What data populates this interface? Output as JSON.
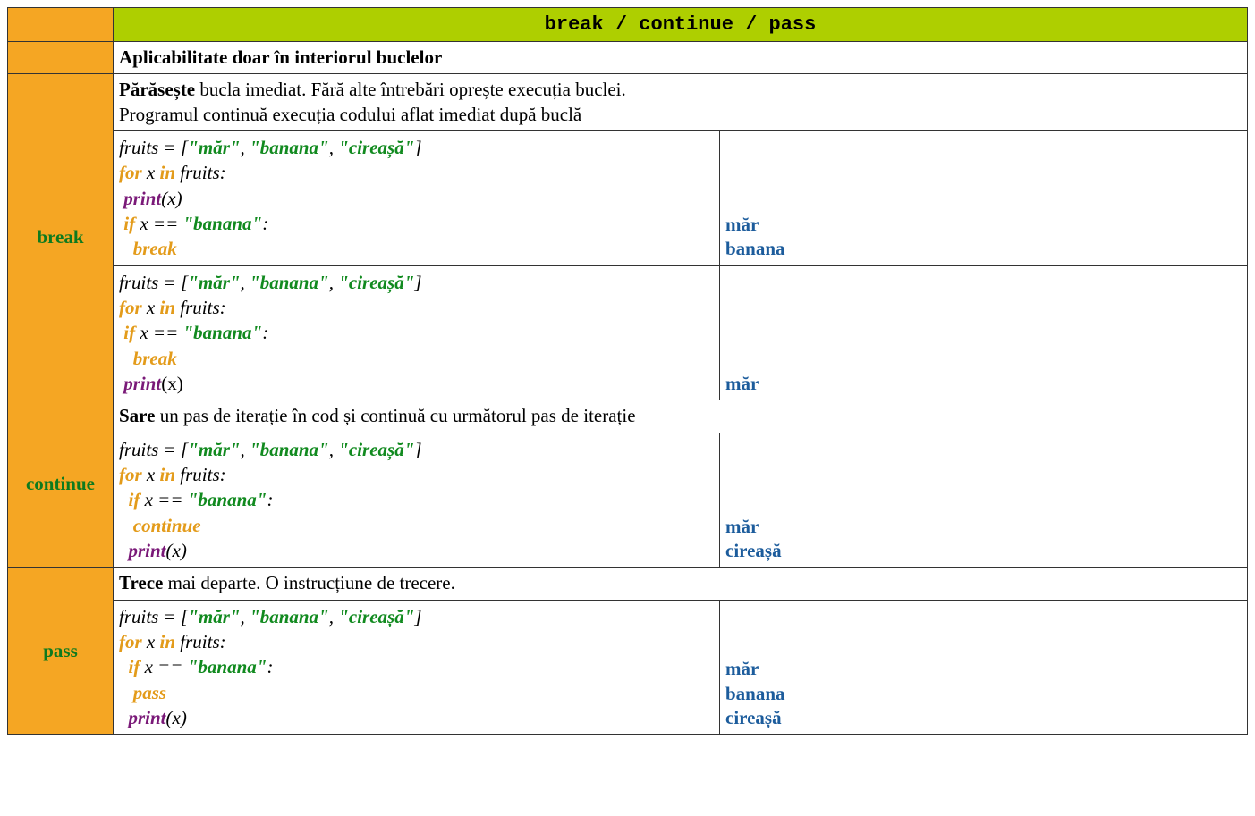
{
  "header": "break / continue / pass",
  "intro": "Aplicabilitate doar în interiorul buclelor",
  "sections": {
    "break": {
      "label": "break",
      "desc_b": "Părăsește",
      "desc_rest": " bucla imediat. Fără alte întrebări oprește execuția buclei.",
      "desc_line2": "Programul continuă execuția codului aflat imediat după buclă",
      "ex": [
        {
          "assign_fruits": "fruits = [",
          "s1": "\"măr\"",
          "c1": ", ",
          "s2": "\"banana\"",
          "c2": ", ",
          "s3": "\"cireașă\"",
          "close": "]",
          "for": "for",
          "x": " x ",
          "in": "in",
          "fruits": " fruits:",
          "print": "print",
          "px": "(x)",
          "if": "if",
          "cond": " x == ",
          "val": "\"banana\"",
          "colon": ":",
          "stmt": "break",
          "out1": "măr",
          "out2": "banana"
        },
        {
          "assign_fruits": "fruits = [",
          "s1": "\"măr\"",
          "c1": ", ",
          "s2": "\"banana\"",
          "c2": ", ",
          "s3": "\"cireașă\"",
          "close": "]",
          "for": "for",
          "x": " x ",
          "in": "in",
          "fruits": " fruits:",
          "if": "if",
          "cond": " x == ",
          "val": "\"banana\"",
          "colon": ":",
          "stmt": "break",
          "print": "print",
          "px": "(x)",
          "out1": "măr"
        }
      ]
    },
    "continue": {
      "label": "continue",
      "desc_b": "Sare",
      "desc_rest": " un pas de iterație în cod și continuă cu următorul pas de iterație",
      "ex": {
        "assign_fruits": "fruits = [",
        "s1": "\"măr\"",
        "c1": ", ",
        "s2": "\"banana\"",
        "c2": ", ",
        "s3": "\"cireașă\"",
        "close": "]",
        "for": "for",
        "x": " x ",
        "in": "in",
        "fruits": " fruits:",
        "if": "if",
        "cond": " x == ",
        "val": "\"banana\"",
        "colon": ":",
        "stmt": "continue",
        "print": "print",
        "px": "(x)",
        "out1": "măr",
        "out2": "cireașă"
      }
    },
    "pass": {
      "label": "pass",
      "desc_b": "Trece",
      "desc_rest": " mai departe. O instrucțiune de trecere.",
      "ex": {
        "assign_fruits": "fruits = [",
        "s1": "\"măr\"",
        "c1": ", ",
        "s2": "\"banana\"",
        "c2": ", ",
        "s3": "\"cireașă\"",
        "close": "]",
        "for": "for",
        "x": " x ",
        "in": "in",
        "fruits": " fruits:",
        "if": "if",
        "cond": " x == ",
        "val": "\"banana\"",
        "colon": ":",
        "stmt": "pass",
        "print": "print",
        "px": "(x)",
        "out1": "măr",
        "out2": "banana",
        "out3": "cireașă"
      }
    }
  }
}
